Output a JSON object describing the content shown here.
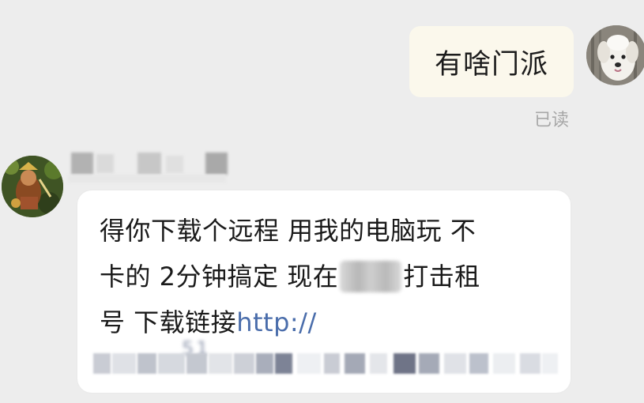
{
  "chat": {
    "outgoing": {
      "text": "有啥门派",
      "read_status": "已读"
    },
    "incoming": {
      "lines": [
        "得你下载个远程  用我的电脑玩  不",
        "卡的  2分钟搞定   现在",
        "打击租",
        "号 下载链接"
      ],
      "link_prefix": "http://",
      "link_fragment": "51"
    }
  },
  "colors": {
    "background": "#ededed",
    "outgoing_bubble": "#fbf8ec",
    "incoming_bubble": "#ffffff",
    "link": "#4a6dab",
    "read_status": "#a7a7a7"
  },
  "icons": {
    "my_avatar": "white-dog-photo-avatar",
    "contact_avatar": "game-character-avatar"
  }
}
